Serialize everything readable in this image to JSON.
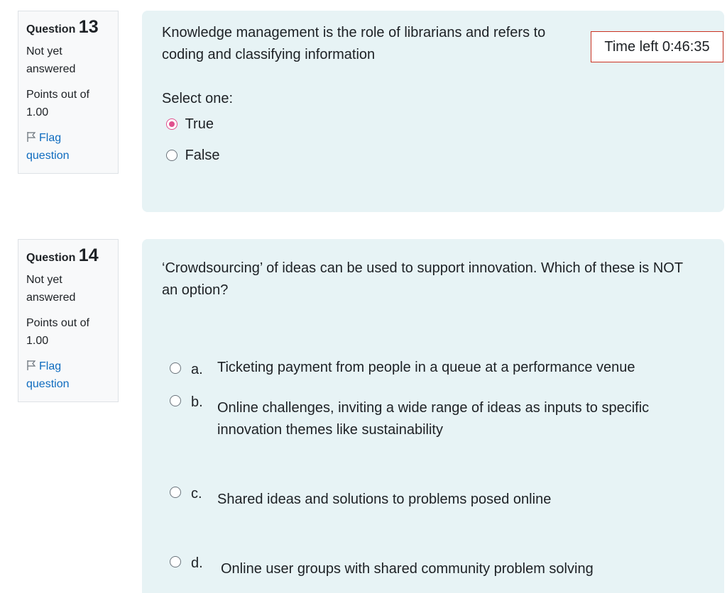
{
  "questions": [
    {
      "label": "Question",
      "number": "13",
      "state": "Not yet answered",
      "grade": "Points out of 1.00",
      "flag": "Flag question",
      "text": "Knowledge management is the role of librarians and refers to coding and classifying information",
      "prompt": "Select one:",
      "options": [
        {
          "label": "True",
          "checked": true
        },
        {
          "label": "False",
          "checked": false
        }
      ]
    },
    {
      "label": "Question",
      "number": "14",
      "state": "Not yet answered",
      "grade": "Points out of 1.00",
      "flag": "Flag question",
      "text": "‘Crowdsourcing’ of ideas can be used to support innovation.  Which of these is NOT an option?",
      "options": [
        {
          "letter": "a.",
          "label": "Ticketing payment from people in a queue at a performance venue",
          "checked": false
        },
        {
          "letter": "b.",
          "label": "Online challenges, inviting  a wide range of ideas as inputs to specific innovation themes like sustainability",
          "checked": false
        },
        {
          "letter": "c.",
          "label": "Shared ideas and solutions to problems posed online",
          "checked": false
        },
        {
          "letter": "d.",
          "label": "Online user groups with shared community problem solving",
          "checked": false
        }
      ]
    }
  ],
  "timer": {
    "text": "Time left 0:46:35"
  },
  "colors": {
    "accent": "#e0508d",
    "link": "#0f6cbf",
    "content_bg": "#e7f3f5",
    "timer_border": "#ca3120"
  }
}
